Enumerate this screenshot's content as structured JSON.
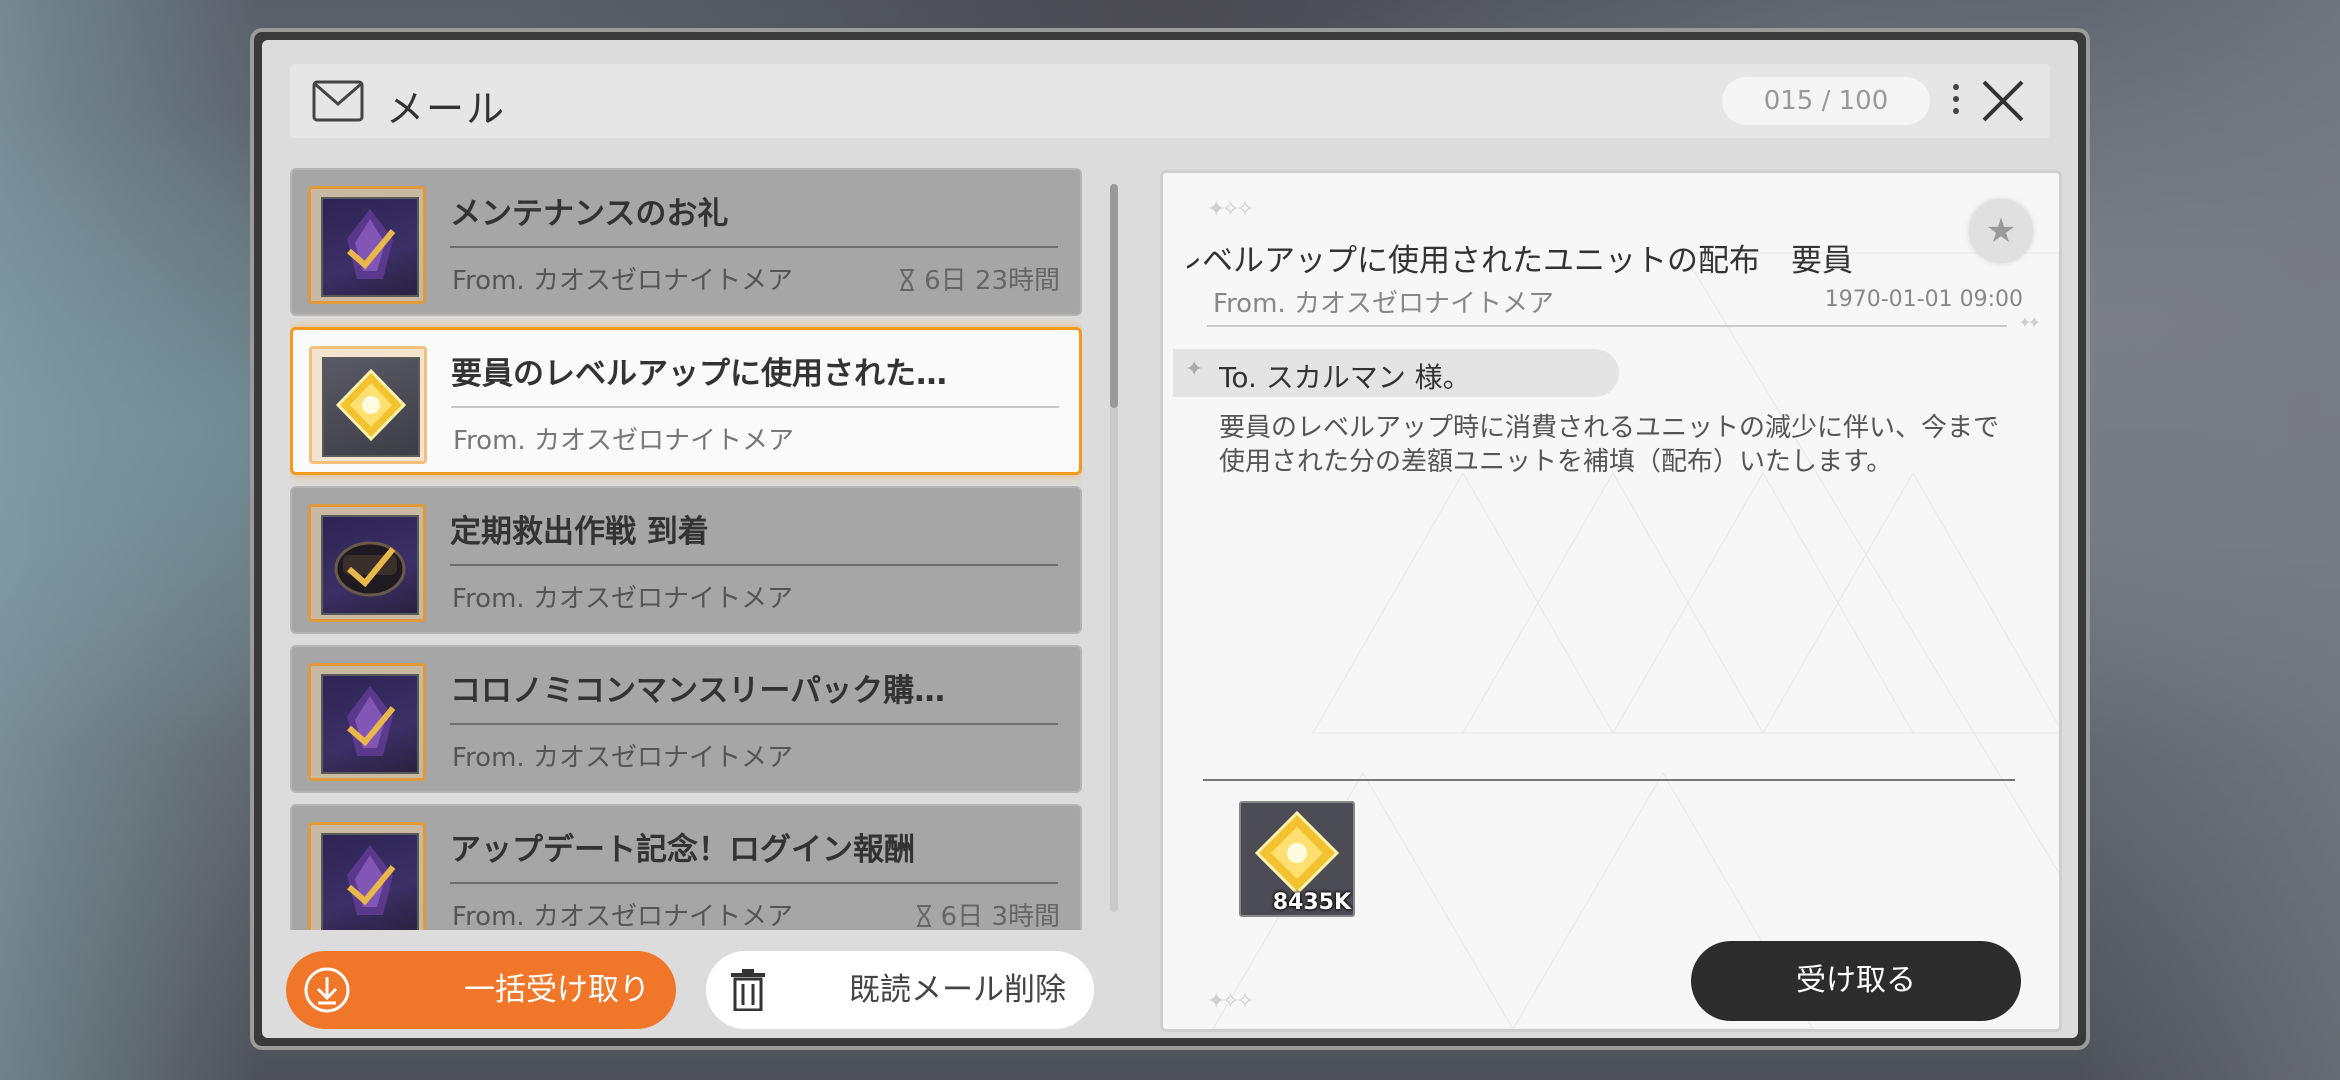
{
  "header": {
    "title": "メール",
    "count": "015 / 100"
  },
  "mail_list": [
    {
      "title": "メンテナンスのお礼",
      "from": "From. カオスゼロナイトメア",
      "expire": "6日 23時間",
      "icon": "purple-crystal-icon",
      "state": "read"
    },
    {
      "title": "要員のレベルアップに使用された…",
      "from": "From. カオスゼロナイトメア",
      "expire": "",
      "icon": "gold-unit-icon",
      "state": "selected"
    },
    {
      "title": "定期救出作戦 到着",
      "from": "From. カオスゼロナイトメア",
      "expire": "",
      "icon": "treasure-chest-icon",
      "state": "read"
    },
    {
      "title": "コロノミコンマンスリーパック購…",
      "from": "From. カオスゼロナイトメア",
      "expire": "",
      "icon": "purple-crystal-icon",
      "state": "read"
    },
    {
      "title": "アップデート記念！ログイン報酬",
      "from": "From. カオスゼロナイトメア",
      "expire": "6日 3時間",
      "icon": "purple-crystal-icon",
      "state": "read"
    }
  ],
  "buttons": {
    "claim_all": "一括受け取り",
    "delete_read": "既読メール削除",
    "receive": "受け取る"
  },
  "detail": {
    "title": "レベルアップに使用されたユニットの配布　要員",
    "from": "From. カオスゼロナイトメア",
    "date": "1970-01-01 09:00",
    "to": "To. スカルマン 様。",
    "body": "要員のレベルアップ時に消費されるユニットの減少に伴い、今まで使用された分の差額ユニットを補填（配布）いたします。",
    "attachment": {
      "icon": "gold-unit-icon",
      "quantity": "8435K"
    }
  },
  "colors": {
    "accent_orange": "#f0772a",
    "selected_border": "#f39a1c",
    "dark_button": "#2c2c2c"
  }
}
